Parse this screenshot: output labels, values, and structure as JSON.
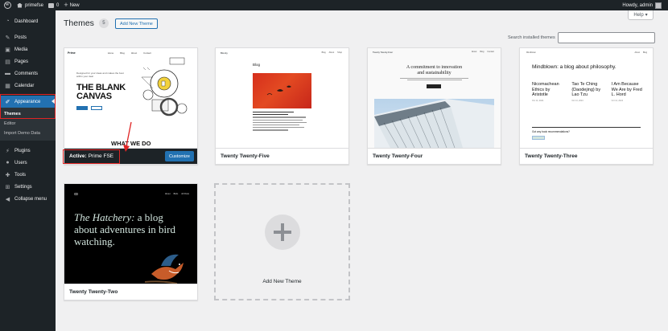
{
  "adminbar": {
    "site_name": "primefse",
    "comments_count": "0",
    "new_label": "New",
    "howdy": "Howdy, admin"
  },
  "sidebar": {
    "items": [
      {
        "label": "Dashboard",
        "icon": "dashboard-icon"
      },
      {
        "label": "Posts",
        "icon": "pin-icon"
      },
      {
        "label": "Media",
        "icon": "media-icon"
      },
      {
        "label": "Pages",
        "icon": "page-icon"
      },
      {
        "label": "Comments",
        "icon": "comment-icon"
      },
      {
        "label": "Calendar",
        "icon": "calendar-icon"
      },
      {
        "label": "Appearance",
        "icon": "brush-icon"
      },
      {
        "label": "Plugins",
        "icon": "plug-icon"
      },
      {
        "label": "Users",
        "icon": "users-icon"
      },
      {
        "label": "Tools",
        "icon": "wrench-icon"
      },
      {
        "label": "Settings",
        "icon": "settings-icon"
      },
      {
        "label": "Collapse menu",
        "icon": "collapse-icon"
      }
    ],
    "submenu": [
      "Themes",
      "Editor",
      "Import Demo Data"
    ]
  },
  "header": {
    "title": "Themes",
    "count": "5",
    "add_new_label": "Add New Theme",
    "help_label": "Help",
    "search_label": "Search installed themes",
    "search_value": ""
  },
  "themes": {
    "active": {
      "active_prefix": "Active:",
      "name": "Prime FSE",
      "customize_label": "Customize",
      "shot": {
        "logo": "Prime",
        "nav": [
          "Home",
          "Blog",
          "About",
          "Contact"
        ],
        "small_text": "Designed for your ideas and makes the best within your deal",
        "headline_1": "THE BLANK",
        "headline_2": "CANVAS",
        "bottom": "WHAT WE DO"
      }
    },
    "tt5": {
      "name": "Twenty Twenty-Five",
      "shot": {
        "site": "Blocky",
        "nav": [
          "Blog",
          "About",
          "Shop"
        ],
        "blog": "Blog"
      }
    },
    "tt4": {
      "name": "Twenty Twenty-Four",
      "shot": {
        "site": "Twenty Twenty-Four",
        "nav": [
          "About",
          "Blog",
          "Contact"
        ],
        "title_1": "A commitment to innovation",
        "title_2": "and sustainability"
      }
    },
    "tt3": {
      "name": "Twenty Twenty-Three",
      "shot": {
        "site": "Mindblown",
        "nav": [
          "About",
          "Blog"
        ],
        "title": "Mindblown: a blog about philosophy.",
        "posts": [
          {
            "title": "Nicomachean Ethics by Aristotle",
            "date": "Oct 14, 2024"
          },
          {
            "title": "Tao Te Ching (Daodejing) by Lao Tzu",
            "date": "Oct 14, 2024"
          },
          {
            "title": "I Am Because We Are by Fred L. Hord",
            "date": "Oct 14, 2024"
          }
        ],
        "ask": "Got any book recommendations?"
      }
    },
    "tt2": {
      "name": "Twenty Twenty-Two",
      "shot": {
        "nav": [
          "About",
          "Birds",
          "All Posts"
        ],
        "italic": "The Hatchery:",
        "rest": " a blog about adventures in bird watching."
      }
    }
  },
  "add_card": {
    "label": "Add New Theme"
  },
  "colors": {
    "admin_dark": "#1d2327",
    "accent": "#2271b1",
    "highlight": "#e02424"
  }
}
